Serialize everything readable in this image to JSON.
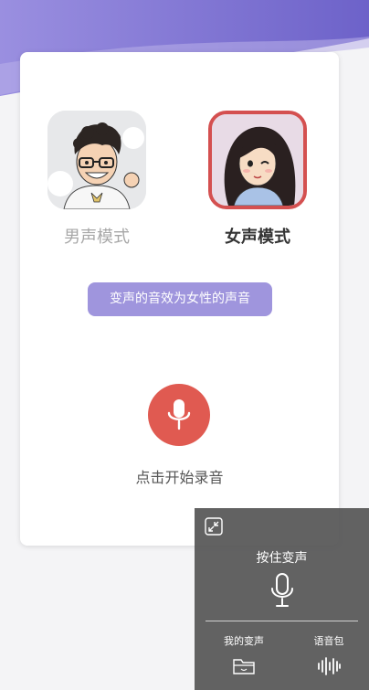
{
  "colors": {
    "header_wave": "#7b6fd1",
    "effect_pill": "#9f95dd",
    "record_button": "#e05a51",
    "selected_border": "#d45050",
    "panel": "#555555"
  },
  "modes": {
    "male": {
      "label": "男声模式",
      "icon": "male-avatar",
      "selected": false
    },
    "female": {
      "label": "女声模式",
      "icon": "female-avatar",
      "selected": true
    }
  },
  "effect_text": "变声的音效为女性的声音",
  "record": {
    "icon": "mic-icon",
    "label": "点击开始录音"
  },
  "float_panel": {
    "shrink_icon": "shrink-icon",
    "hold_label": "按住变声",
    "tabs": [
      {
        "label": "我的变声",
        "icon": "folder-icon"
      },
      {
        "label": "语音包",
        "icon": "waveform-icon"
      }
    ]
  }
}
